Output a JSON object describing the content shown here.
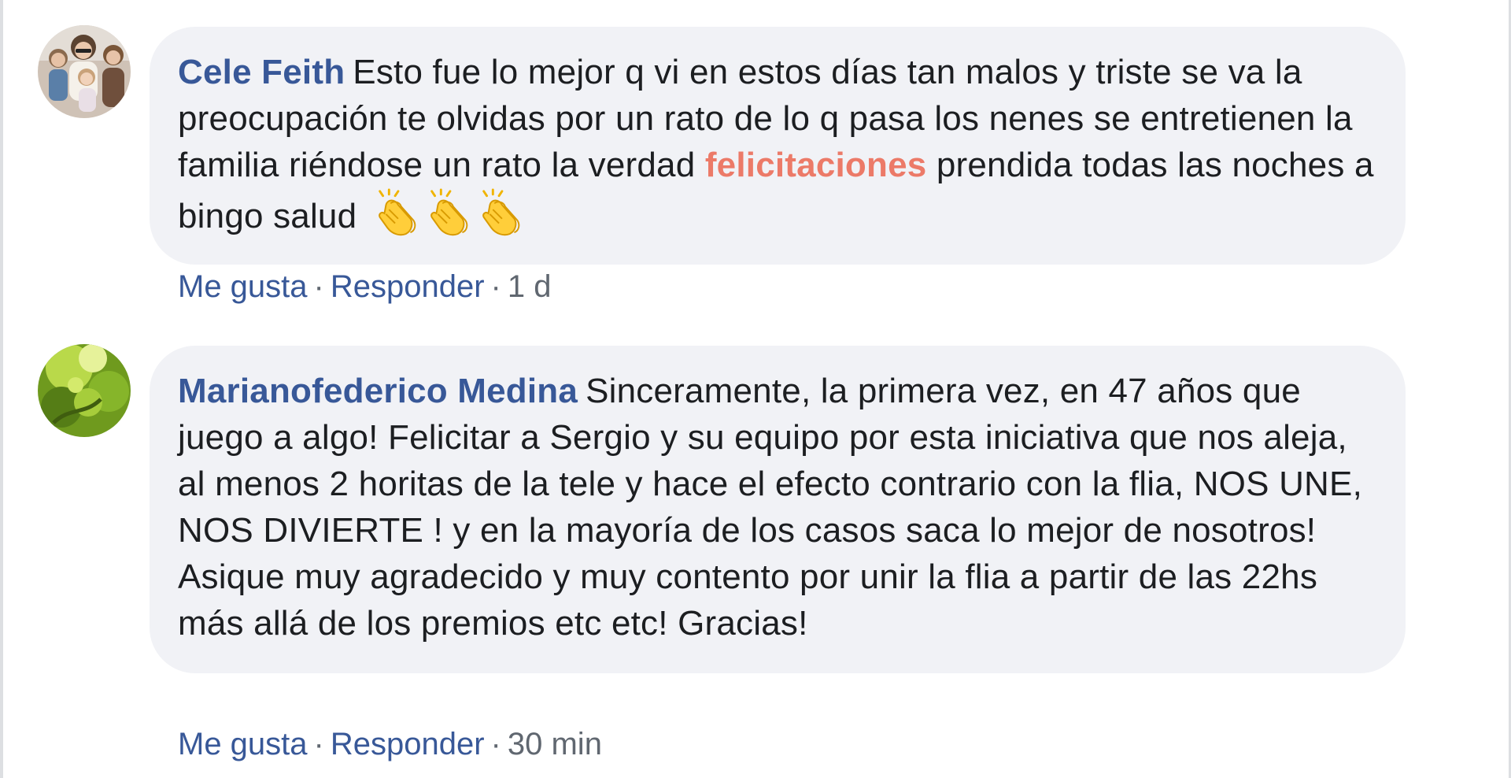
{
  "comments": [
    {
      "author": "Cele Feith",
      "text_before": "Esto fue lo mejor q vi en estos días tan malos y triste se va la preocupación te olvidas por un rato de lo q pasa los nenes se entretienen la familia riéndose un rato la verdad ",
      "highlight": "felicitaciones",
      "text_after": " prendida todas las noches a bingo salud",
      "emojis": [
        "clapping-hands",
        "clapping-hands",
        "clapping-hands"
      ],
      "like_label": "Me gusta",
      "reply_label": "Responder",
      "time": "1 d",
      "avatar_icon": "family-photo-avatar"
    },
    {
      "author": "Marianofederico Medina",
      "text": "Sinceramente, la primera vez, en 47 años que juego a algo! Felicitar a Sergio y su equipo por esta iniciativa que nos aleja, al menos 2 horitas de la tele y hace el efecto contrario con la flia, NOS UNE, NOS DIVIERTE ! y en la mayoría de los casos saca lo mejor de nosotros! Asique muy agradecido y muy contento por unir la flia a partir de las 22hs más allá de los premios etc etc! Gracias!",
      "like_label": "Me gusta",
      "reply_label": "Responder",
      "time": "30 min",
      "avatar_icon": "green-leaves-avatar"
    }
  ],
  "separator": "·",
  "colors": {
    "author": "#385898",
    "highlight": "#ec7a68",
    "bubble": "#f1f2f6",
    "meta": "#606770"
  }
}
